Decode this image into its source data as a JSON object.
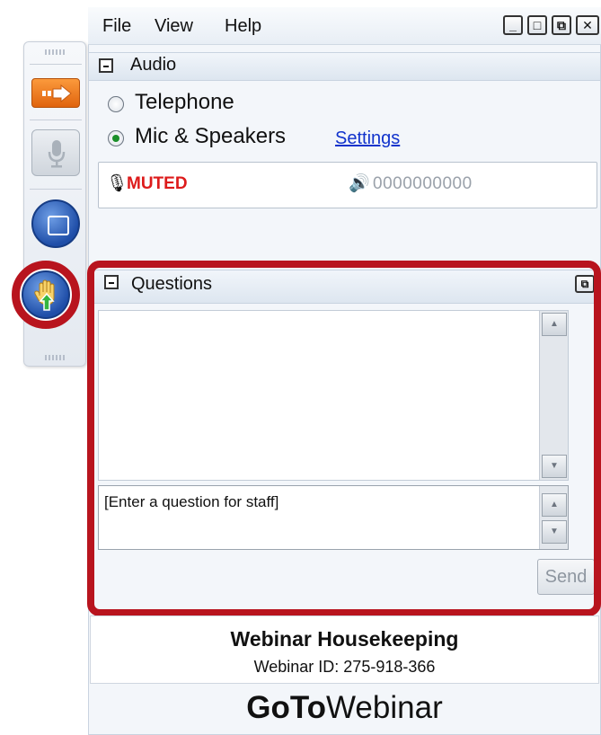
{
  "menu": {
    "file": "File",
    "view": "View",
    "help": "Help"
  },
  "window_controls": {
    "minimize": "_",
    "maximize": "□",
    "restore": "⧉",
    "close": "✕"
  },
  "audio": {
    "section_title": "Audio",
    "telephone_label": "Telephone",
    "mic_label": "Mic & Speakers",
    "settings_link": "Settings",
    "selected_option": "Mic & Speakers",
    "mic_status": "MUTED",
    "mic_icon": "🎙",
    "speaker_icon": "🔊",
    "level_indicator": "0000000000"
  },
  "questions": {
    "section_title": "Questions",
    "input_placeholder": "[Enter a question for staff]",
    "send_label": "Send"
  },
  "footer": {
    "webinar_title": "Webinar Housekeeping",
    "webinar_id": "Webinar ID: 275-918-366",
    "brand_bold": "GoTo",
    "brand_regular": "Webinar"
  },
  "colors": {
    "highlight": "#b8141e",
    "muted": "#dd1b1b",
    "link": "#1133cc",
    "orange_button": "#f07d22",
    "blue_button": "#2a5bbd"
  },
  "icons": {
    "arrow_button": "arrow-right-icon",
    "mic_button": "microphone-icon",
    "screen_button": "screen-icon",
    "hand_button": "raise-hand-icon"
  }
}
